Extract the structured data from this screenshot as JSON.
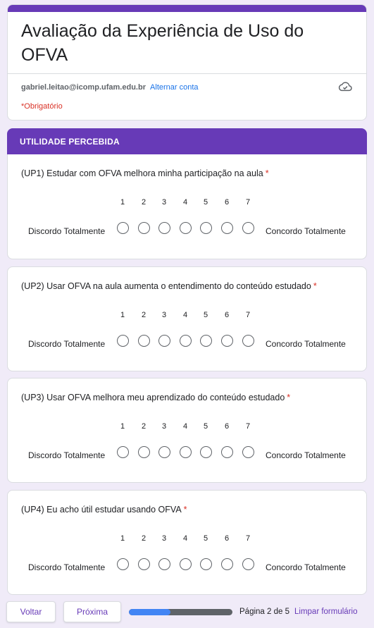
{
  "form": {
    "title": "Avaliação da Experiência de Uso do OFVA",
    "account_email": "gabriel.leitao@icomp.ufam.edu.br",
    "switch_account": "Alternar conta",
    "required_note": "*Obrigatório",
    "cloud_icon": "cloud-check-icon"
  },
  "section": {
    "title": "UTILIDADE PERCEBIDA"
  },
  "scale": {
    "numbers": [
      "1",
      "2",
      "3",
      "4",
      "5",
      "6",
      "7"
    ],
    "low_label": "Discordo Totalmente",
    "high_label": "Concordo Totalmente"
  },
  "questions": [
    {
      "title": "(UP1) Estudar com OFVA melhora minha participação na aula",
      "required": "*"
    },
    {
      "title": "(UP2) Usar OFVA na aula aumenta o entendimento do conteúdo estudado",
      "required": "*"
    },
    {
      "title": "(UP3) Usar OFVA melhora meu aprendizado do conteúdo estudado",
      "required": "*"
    },
    {
      "title": "(UP4) Eu acho útil estudar usando OFVA",
      "required": "*"
    }
  ],
  "footer": {
    "back_label": "Voltar",
    "next_label": "Próxima",
    "progress_fraction": 0.4,
    "page_indicator": "Página 2 de 5",
    "clear_label": "Limpar formulário"
  },
  "colors": {
    "accent": "#673ab7",
    "background": "#f0ebf8",
    "required": "#d93025",
    "link": "#1a73e8",
    "progress": "#4285f4"
  }
}
